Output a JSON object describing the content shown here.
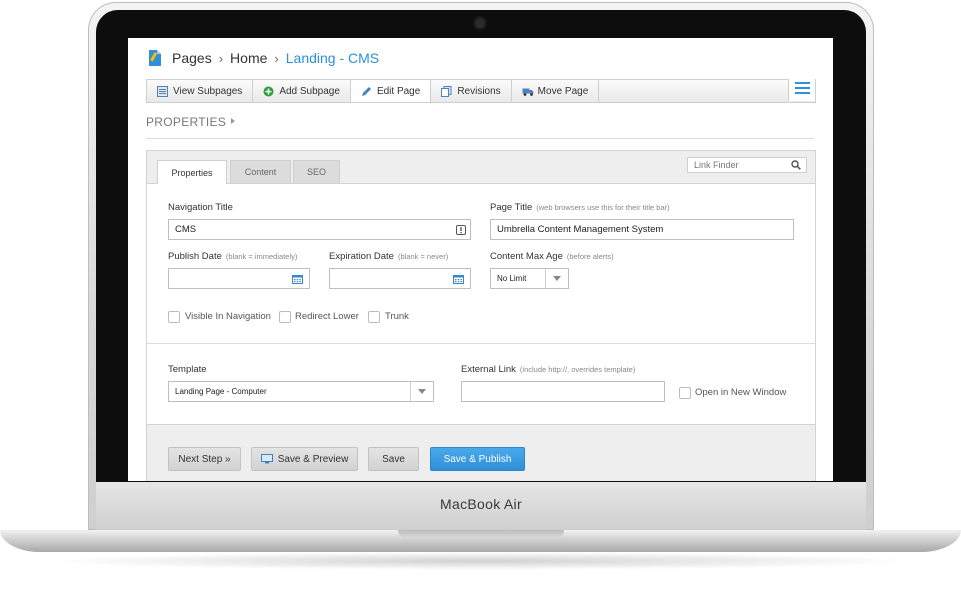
{
  "device": {
    "brand": "MacBook Air"
  },
  "breadcrumb": {
    "items": [
      "Pages",
      "Home"
    ],
    "current": "Landing - CMS",
    "separator": "›"
  },
  "toolbar": {
    "view_subpages": "View Subpages",
    "add_subpage": "Add Subpage",
    "edit_page": "Edit Page",
    "revisions": "Revisions",
    "move_page": "Move Page"
  },
  "section": {
    "heading": "PROPERTIES"
  },
  "tabs": {
    "properties": "Properties",
    "content": "Content",
    "seo": "SEO"
  },
  "link_finder": {
    "placeholder": "Link Finder"
  },
  "form": {
    "nav_title_label": "Navigation Title",
    "nav_title_value": "CMS",
    "page_title_label": "Page Title",
    "page_title_hint": "(web browsers use this for their title bar)",
    "page_title_value": "Umbrella Content Management System",
    "publish_date_label": "Publish Date",
    "publish_date_hint": "(blank = immediately)",
    "expiration_date_label": "Expiration Date",
    "expiration_date_hint": "(blank = never)",
    "content_max_age_label": "Content Max Age",
    "content_max_age_hint": "(before alerts)",
    "content_max_age_value": "No Limit",
    "visible_in_nav": "Visible In Navigation",
    "redirect_lower": "Redirect Lower",
    "trunk": "Trunk",
    "template_label": "Template",
    "template_value": "Landing Page - Computer",
    "external_link_label": "External Link",
    "external_link_hint": "(include http://, overrides template)",
    "open_new_window": "Open in New Window"
  },
  "buttons": {
    "next_step": "Next Step »",
    "save_preview": "Save & Preview",
    "save": "Save",
    "save_publish": "Save & Publish"
  },
  "colors": {
    "accent": "#2f8fd8",
    "primary_button": "#3a9be0"
  }
}
